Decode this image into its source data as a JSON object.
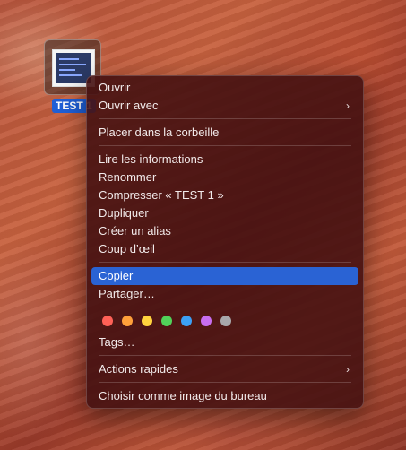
{
  "desktop_file": {
    "name": "TEST 1"
  },
  "context_menu": {
    "open": "Ouvrir",
    "open_with": "Ouvrir avec",
    "move_to_trash": "Placer dans la corbeille",
    "get_info": "Lire les informations",
    "rename": "Renommer",
    "compress": "Compresser « TEST 1 »",
    "duplicate": "Dupliquer",
    "make_alias": "Créer un alias",
    "quick_look": "Coup d’œil",
    "copy": "Copier",
    "share": "Partager…",
    "tags": "Tags…",
    "quick_actions": "Actions rapides",
    "set_desktop_picture": "Choisir comme image du bureau",
    "submenu_icon": "chevron-right-icon",
    "highlighted_item": "Copier",
    "tag_colors": [
      "#ff6157",
      "#ffa03a",
      "#ffd33d",
      "#51d25a",
      "#3ca0f5",
      "#c86ef0",
      "#a8a8ab"
    ]
  }
}
